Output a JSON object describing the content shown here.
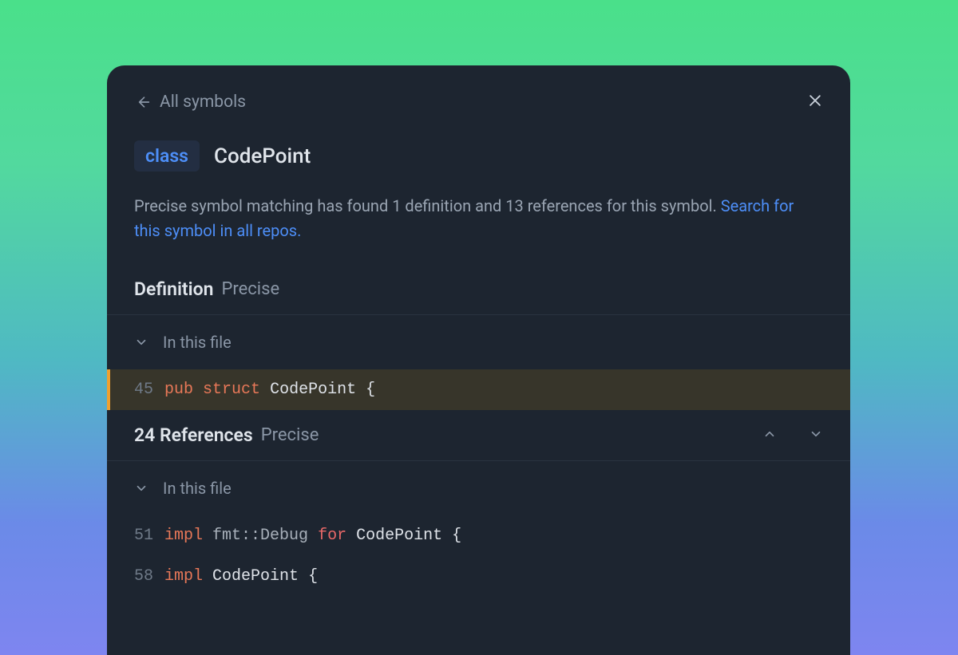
{
  "header": {
    "back_label": "All symbols"
  },
  "symbol": {
    "badge": "class",
    "name": "CodePoint"
  },
  "description": {
    "text": "Precise symbol matching has found 1 definition and 13 references for this symbol.",
    "link": "Search for this symbol in all repos."
  },
  "definition": {
    "title": "Definition",
    "sub": "Precise",
    "collapse_label": "In this file",
    "line": {
      "no": "45",
      "tokens": {
        "pub": "pub",
        "struct": "struct",
        "name": "CodePoint",
        "brace": "{"
      }
    }
  },
  "references": {
    "title": "24 References",
    "sub": "Precise",
    "collapse_label": "In this file",
    "lines": [
      {
        "no": "51",
        "impl": "impl",
        "path": "fmt::Debug",
        "for": "for",
        "name": "CodePoint",
        "brace": "{"
      },
      {
        "no": "58",
        "impl": "impl",
        "name": "CodePoint",
        "brace": "{"
      }
    ]
  }
}
